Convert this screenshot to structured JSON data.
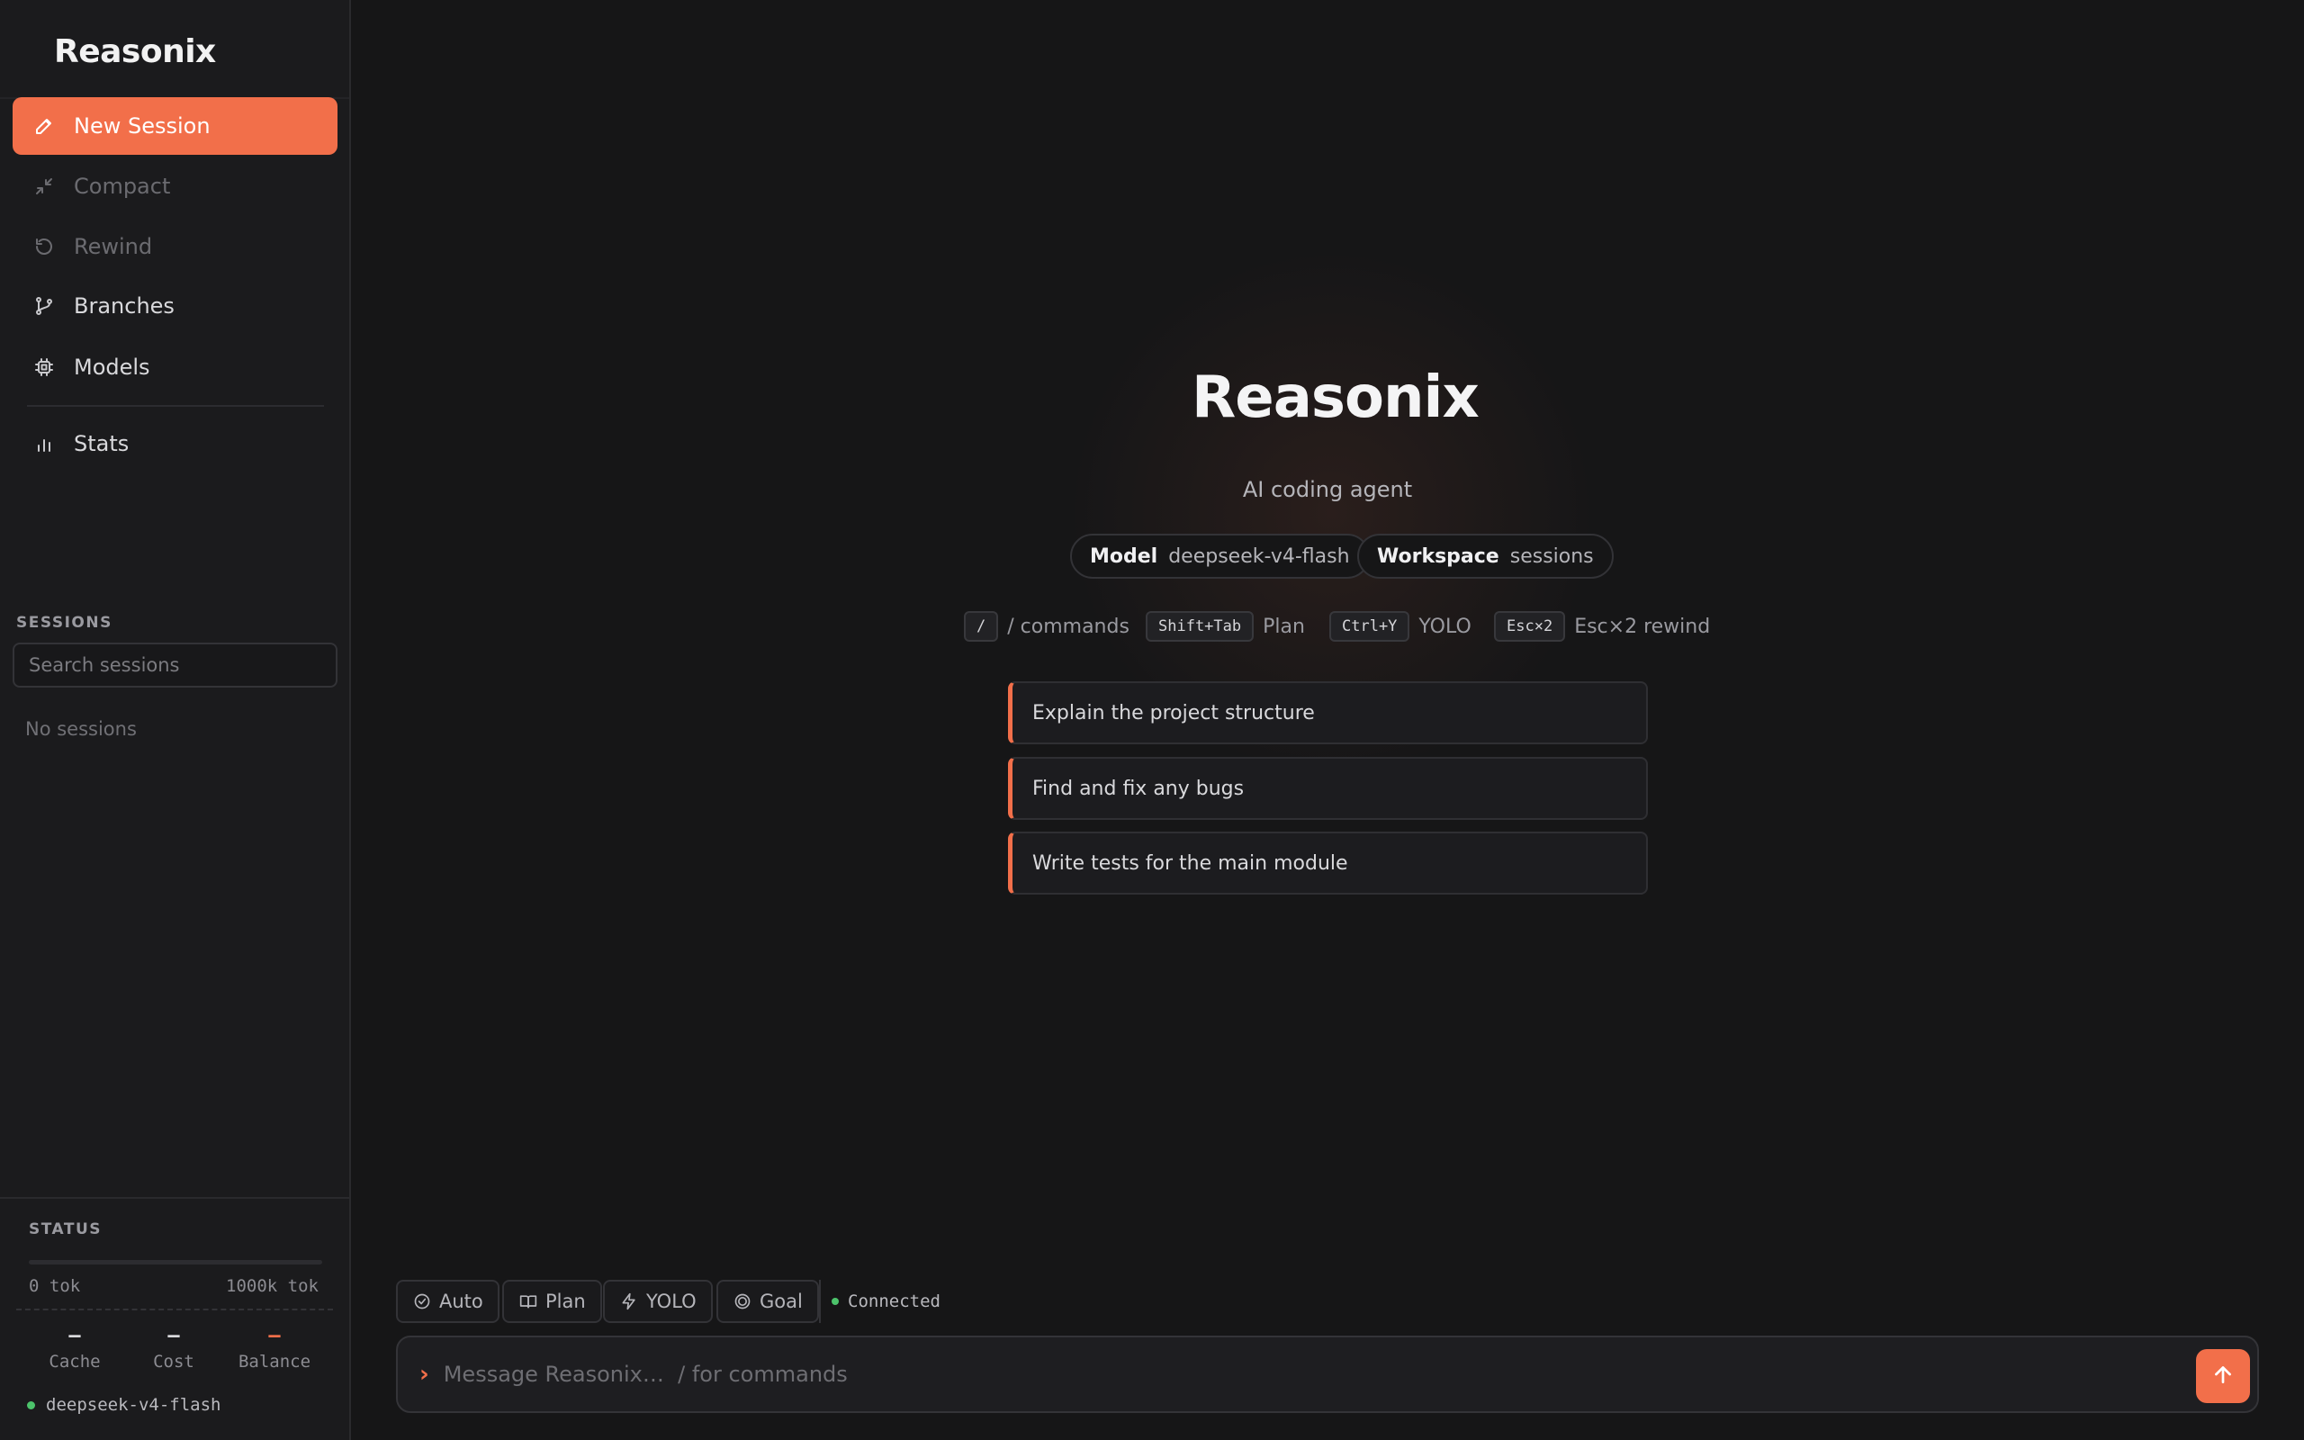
{
  "app": {
    "name": "Reasonix"
  },
  "sidebar": {
    "nav": [
      {
        "label": "New Session",
        "icon": "pencil-icon",
        "state": "active"
      },
      {
        "label": "Compact",
        "icon": "compress-icon",
        "state": "disabled"
      },
      {
        "label": "Rewind",
        "icon": "rewind-icon",
        "state": "disabled"
      },
      {
        "label": "Branches",
        "icon": "branch-icon",
        "state": "normal"
      },
      {
        "label": "Models",
        "icon": "chip-icon",
        "state": "normal"
      },
      {
        "label": "Stats",
        "icon": "bar-chart-icon",
        "state": "normal"
      }
    ],
    "sessions": {
      "heading": "SESSIONS",
      "search_placeholder": "Search sessions",
      "empty_text": "No sessions"
    },
    "status": {
      "heading": "STATUS",
      "tok_min": "0 tok",
      "tok_max": "1000k tok",
      "cache_value": "–",
      "cache_label": "Cache",
      "cost_value": "–",
      "cost_label": "Cost",
      "balance_value": "–",
      "balance_label": "Balance",
      "model": "deepseek-v4-flash"
    }
  },
  "hero": {
    "title": "Reasonix",
    "subtitle": "AI coding agent",
    "model_key": "Model",
    "model_value": "deepseek-v4-flash",
    "workspace_key": "Workspace",
    "workspace_value": "sessions",
    "shortcuts": [
      {
        "key": "/",
        "desc": "/ commands"
      },
      {
        "key": "Shift+Tab",
        "desc": "Plan"
      },
      {
        "key": "Ctrl+Y",
        "desc": "YOLO"
      },
      {
        "key": "Esc×2",
        "desc": "Esc×2 rewind"
      }
    ],
    "suggestions": [
      "Explain the project structure",
      "Find and fix any bugs",
      "Write tests for the main module"
    ]
  },
  "modes": {
    "auto": "Auto",
    "plan": "Plan",
    "yolo": "YOLO",
    "goal": "Goal",
    "connection": "Connected"
  },
  "composer": {
    "placeholder": "Message Reasonix…  / for commands"
  },
  "colors": {
    "accent": "#f26f4a",
    "connected": "#4cc36b"
  }
}
